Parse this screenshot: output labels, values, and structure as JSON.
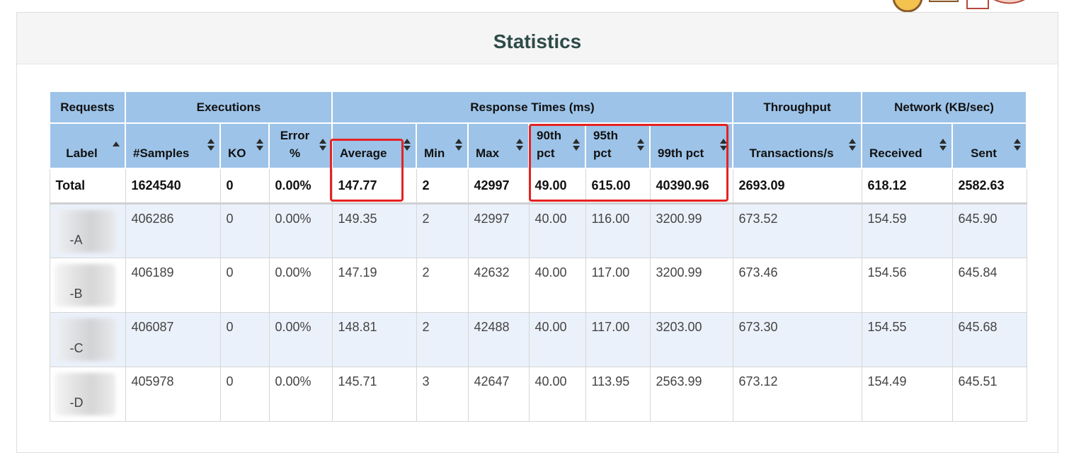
{
  "title": "Statistics",
  "group_headers": {
    "requests": "Requests",
    "executions": "Executions",
    "response_times": "Response Times (ms)",
    "throughput": "Throughput",
    "network": "Network (KB/sec)"
  },
  "columns": {
    "label": "Label",
    "samples": "#Samples",
    "ko": "KO",
    "error_line1": "Error",
    "error_line2": "%",
    "average": "Average",
    "min": "Min",
    "max": "Max",
    "p90_line1": "90th",
    "p90_line2": "pct",
    "p95_line1": "95th",
    "p95_line2": "pct",
    "p99": "99th pct",
    "transactions": "Transactions/s",
    "received": "Received",
    "sent": "Sent"
  },
  "total": {
    "label": "Total",
    "samples": "1624540",
    "ko": "0",
    "error": "0.00%",
    "average": "147.77",
    "min": "2",
    "max": "42997",
    "p90": "49.00",
    "p95": "615.00",
    "p99": "40390.96",
    "transactions": "2693.09",
    "received": "618.12",
    "sent": "2582.63"
  },
  "rows": [
    {
      "label": "-A",
      "samples": "406286",
      "ko": "0",
      "error": "0.00%",
      "average": "149.35",
      "min": "2",
      "max": "42997",
      "p90": "40.00",
      "p95": "116.00",
      "p99": "3200.99",
      "transactions": "673.52",
      "received": "154.59",
      "sent": "645.90"
    },
    {
      "label": "-B",
      "samples": "406189",
      "ko": "0",
      "error": "0.00%",
      "average": "147.19",
      "min": "2",
      "max": "42632",
      "p90": "40.00",
      "p95": "117.00",
      "p99": "3200.99",
      "transactions": "673.46",
      "received": "154.56",
      "sent": "645.84"
    },
    {
      "label": "-C",
      "samples": "406087",
      "ko": "0",
      "error": "0.00%",
      "average": "148.81",
      "min": "2",
      "max": "42488",
      "p90": "40.00",
      "p95": "117.00",
      "p99": "3203.00",
      "transactions": "673.30",
      "received": "154.55",
      "sent": "645.68"
    },
    {
      "label": "-D",
      "samples": "405978",
      "ko": "0",
      "error": "0.00%",
      "average": "145.71",
      "min": "3",
      "max": "42647",
      "p90": "40.00",
      "p95": "113.95",
      "p99": "2563.99",
      "transactions": "673.12",
      "received": "154.49",
      "sent": "645.51"
    }
  ],
  "colors": {
    "header_bg": "#9dc3e8",
    "row_alt_bg": "#ebf1fa",
    "highlight": "#e52222",
    "title": "#2e4b47"
  }
}
